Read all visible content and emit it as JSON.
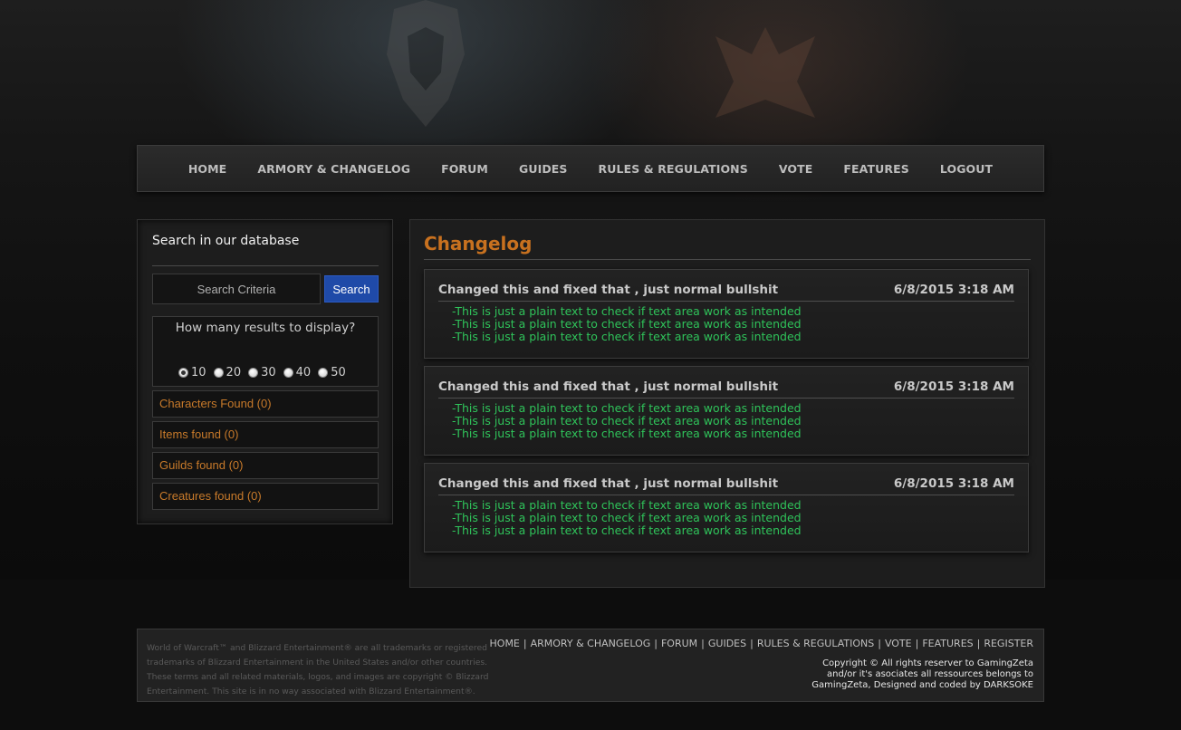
{
  "nav": {
    "items": [
      "HOME",
      "ARMORY & CHANGELOG",
      "FORUM",
      "GUIDES",
      "RULES & REGULATIONS",
      "VOTE",
      "FEATURES",
      "LOGOUT"
    ]
  },
  "search": {
    "title": "Search in our database",
    "placeholder": "Search Criteria",
    "button_label": "Search",
    "results_label": "How many results to display?",
    "result_options": [
      "10",
      "20",
      "30",
      "40",
      "50"
    ],
    "selected_option": "10",
    "found": [
      "Characters Found (0)",
      "Items found (0)",
      "Guilds found (0)",
      "Creatures found (0)"
    ]
  },
  "changelog": {
    "title": "Changelog",
    "entries": [
      {
        "title": "Changed this and fixed that , just normal bullshit",
        "date": "6/8/2015 3:18 AM",
        "lines": [
          "-This is just a plain text to check if text area work as intended",
          "-This is just a plain text to check if text area work as intended",
          "-This is just a plain text to check if text area work as intended"
        ]
      },
      {
        "title": "Changed this and fixed that , just normal bullshit",
        "date": "6/8/2015 3:18 AM",
        "lines": [
          "-This is just a plain text to check if text area work as intended",
          "-This is just a plain text to check if text area work as intended",
          "-This is just a plain text to check if text area work as intended"
        ]
      },
      {
        "title": "Changed this and fixed that , just normal bullshit",
        "date": "6/8/2015 3:18 AM",
        "lines": [
          "-This is just a plain text to check if text area work as intended",
          "-This is just a plain text to check if text area work as intended",
          "-This is just a plain text to check if text area work as intended"
        ]
      }
    ]
  },
  "footer": {
    "legal": "World of Warcraft™ and Blizzard Entertainment® are all trademarks or registered trademarks of Blizzard Entertainment in the United States and/or other countries. These terms and all related materials, logos, and images are copyright © Blizzard Entertainment. This site is in no way associated with Blizzard Entertainment®.",
    "links": [
      "HOME",
      "ARMORY & CHANGELOG",
      "FORUM",
      "GUIDES",
      "RULES & REGULATIONS",
      "VOTE",
      "FEATURES",
      "REGISTER"
    ],
    "copyright": "Copyright © All rights reserver to GamingZeta and/or it's asociates all ressources belongs to GamingZeta, Designed and coded by DARKSOKE"
  },
  "colors": {
    "accent_orange": "#c8711f",
    "changelog_text_green": "#2fc35a",
    "search_button_blue": "#1f4aa8"
  }
}
